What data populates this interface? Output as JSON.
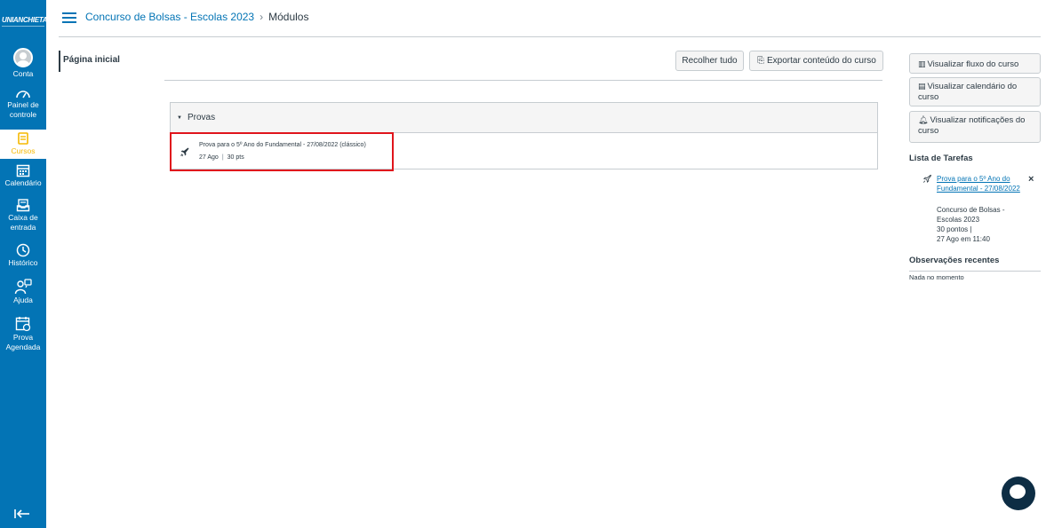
{
  "brand": {
    "logo_text": "UNIANCHIETA",
    "nav_color": "#0374B5"
  },
  "global_nav": {
    "items": [
      {
        "label": "Conta",
        "icon": "account-icon"
      },
      {
        "label": "Painel de controle",
        "icon": "dashboard-icon"
      },
      {
        "label": "Cursos",
        "icon": "courses-icon",
        "active": true
      },
      {
        "label": "Calendário",
        "icon": "calendar-icon"
      },
      {
        "label": "Caixa de entrada",
        "icon": "inbox-icon"
      },
      {
        "label": "Histórico",
        "icon": "history-icon"
      },
      {
        "label": "Ajuda",
        "icon": "help-icon"
      },
      {
        "label": "Prova Agendada",
        "icon": "scheduled-exam-icon"
      }
    ],
    "collapse_icon": "collapse-nav-icon"
  },
  "breadcrumb": {
    "course": "Concurso de Bolsas - Escolas 2023",
    "current": "Módulos"
  },
  "course_nav": {
    "items": [
      {
        "label": "Página inicial"
      }
    ]
  },
  "toolbar": {
    "collapse_all": "Recolher tudo",
    "export": "Exportar conteúdo do curso"
  },
  "module": {
    "title": "Provas",
    "items": [
      {
        "title": "Prova para o 5º Ano do Fundamental - 27/08/2022 (clássico)",
        "date": "27 Ago",
        "points": "30 pts",
        "icon": "quiz-rocket-icon"
      }
    ]
  },
  "sidebar": {
    "buttons": {
      "stream": "Visualizar fluxo do curso",
      "calendar": "Visualizar calendário do curso",
      "notifications": "Visualizar notificações do curso"
    },
    "todo": {
      "title": "Lista de Tarefas",
      "item": {
        "link": "Prova para o 5º Ano do Fundamental - 27/08/2022",
        "course": "Concurso de Bolsas - Escolas 2023",
        "points": "30 pontos  |",
        "date": "27 Ago em 11:40",
        "close": "×"
      }
    },
    "recent": {
      "title": "Observações recentes",
      "empty": "Nada no momento"
    }
  },
  "colors": {
    "highlight": "#e0151c",
    "link": "#0374B5"
  }
}
